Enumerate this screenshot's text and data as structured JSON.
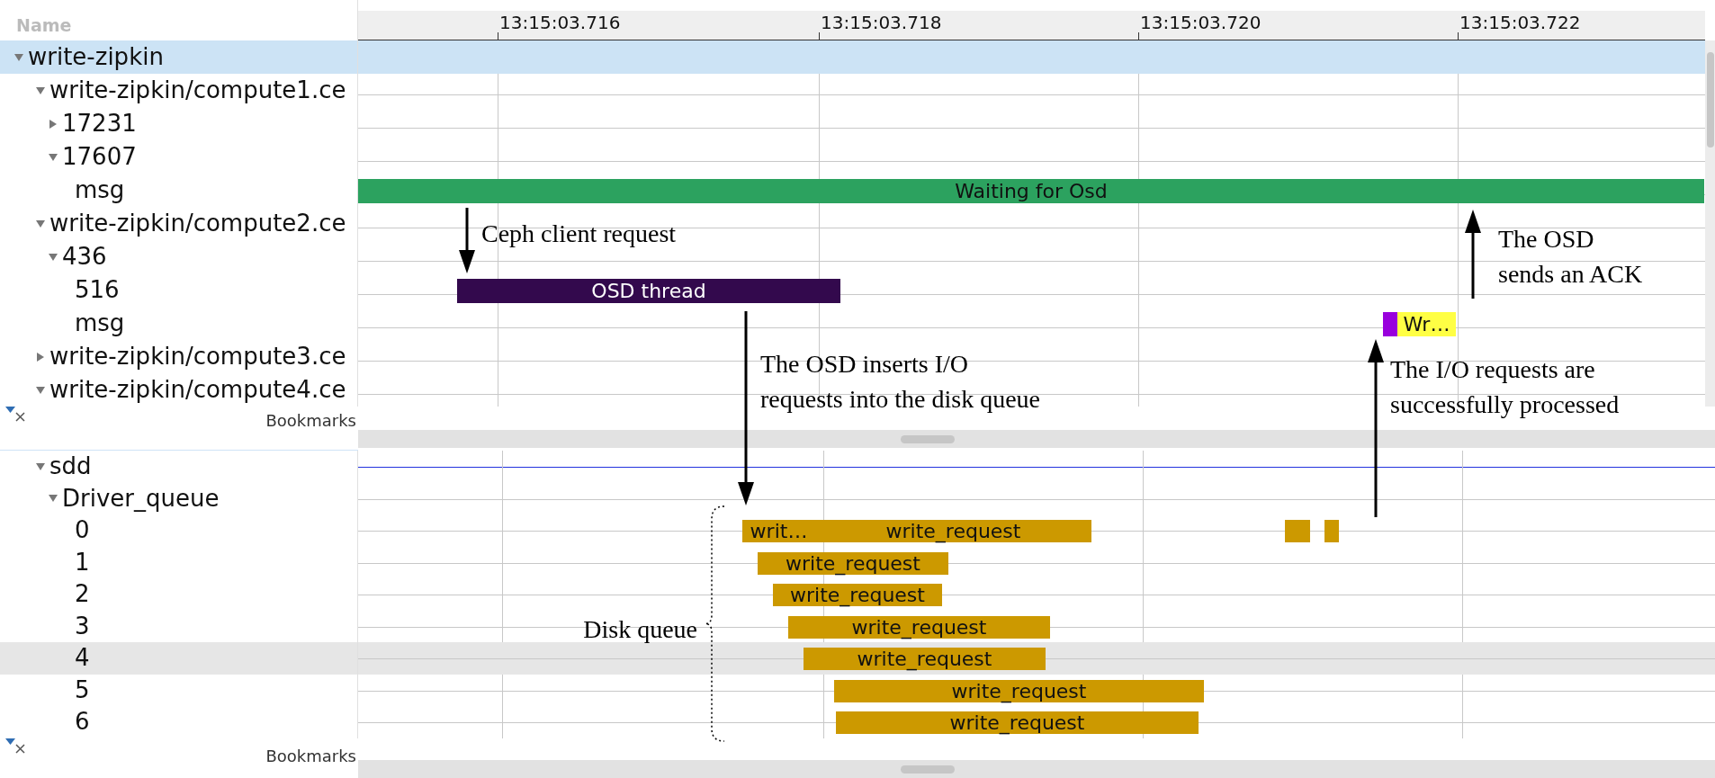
{
  "tree_header": "Name",
  "top_pane": {
    "time_ticks": [
      "13:15:03.716",
      "13:15:03.718",
      "13:15:03.720",
      "13:15:03.722"
    ],
    "tree": [
      {
        "label": "write-zipkin",
        "expanded": true,
        "selected": true,
        "children": [
          {
            "label": "write-zipkin/compute1.ce",
            "expanded": true,
            "selected": false,
            "children": [
              {
                "label": "17231",
                "expanded": false,
                "selected": false
              },
              {
                "label": "17607",
                "expanded": true,
                "selected": false,
                "children": [
                  {
                    "label": "msg",
                    "selected": false
                  }
                ]
              }
            ]
          },
          {
            "label": "write-zipkin/compute2.ce",
            "expanded": true,
            "selected": false,
            "children": [
              {
                "label": "436",
                "expanded": true,
                "selected": false,
                "children": [
                  {
                    "label": "516",
                    "selected": false
                  },
                  {
                    "label": "msg",
                    "selected": false
                  }
                ]
              }
            ]
          },
          {
            "label": "write-zipkin/compute3.ce",
            "expanded": false,
            "selected": false
          },
          {
            "label": "write-zipkin/compute4.ce",
            "expanded": true,
            "selected": false
          }
        ]
      }
    ],
    "states": [
      {
        "label": "Waiting for Osd",
        "color": "#2ca25f"
      },
      {
        "label": "OSD thread",
        "color": "#33094d"
      },
      {
        "color": "#9900dd"
      },
      {
        "label": "Wr…",
        "color": "#ffff44"
      }
    ],
    "bookmarks_label": "Bookmarks"
  },
  "bottom_pane": {
    "tree": [
      {
        "label": "sdd",
        "expanded": true,
        "selected": false,
        "children": [
          {
            "label": "Driver_queue",
            "expanded": true,
            "selected": false,
            "children": [
              {
                "label": "0",
                "selected": false
              },
              {
                "label": "1",
                "selected": false
              },
              {
                "label": "2",
                "selected": false
              },
              {
                "label": "3",
                "selected": false
              },
              {
                "label": "4",
                "selected": true
              },
              {
                "label": "5",
                "selected": false
              },
              {
                "label": "6",
                "selected": false
              }
            ]
          }
        ]
      }
    ],
    "states": [
      {
        "label": "writ…",
        "color": "#cc9900"
      },
      {
        "label": "write_request",
        "color": "#cc9900"
      },
      {
        "color": "#cc9900"
      },
      {
        "color": "#cc9900"
      },
      {
        "label": "write_request",
        "color": "#cc9900"
      },
      {
        "label": "write_request",
        "color": "#cc9900"
      },
      {
        "label": "write_request",
        "color": "#cc9900"
      },
      {
        "label": "write_request",
        "color": "#cc9900"
      },
      {
        "label": "write_request",
        "color": "#cc9900"
      },
      {
        "label": "write_request",
        "color": "#cc9900"
      }
    ],
    "bookmarks_label": "Bookmarks"
  },
  "annotations": [
    {
      "kind": "arrow-down",
      "lines": [
        "Ceph client request"
      ]
    },
    {
      "kind": "arrow-down",
      "lines": [
        "The OSD inserts I/O",
        "requests into the disk queue"
      ]
    },
    {
      "kind": "arrow-up",
      "lines": [
        "The OSD",
        "sends an ACK"
      ]
    },
    {
      "kind": "arrow-up",
      "lines": [
        "The I/O requests are",
        "successfully processed"
      ]
    },
    {
      "kind": "brace",
      "lines": [
        "Disk queue"
      ]
    }
  ]
}
